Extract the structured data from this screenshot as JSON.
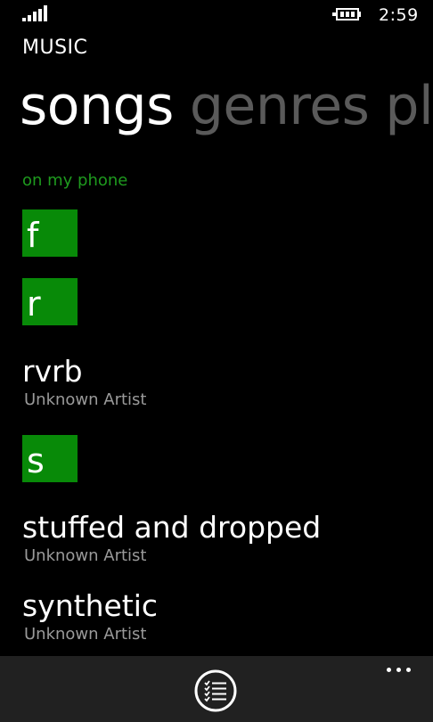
{
  "status_bar": {
    "signal_icon": "signal-strength-icon",
    "battery_icon": "battery-charging-icon",
    "time": "2:59"
  },
  "app": {
    "title": "MUSIC"
  },
  "pivot": {
    "items": [
      {
        "label": "songs",
        "active": true
      },
      {
        "label": "genres",
        "active": false
      },
      {
        "label": "playlists",
        "active": false
      }
    ]
  },
  "list": {
    "section_label": "on my phone",
    "groups": [
      {
        "letter": "f",
        "songs": []
      },
      {
        "letter": "r",
        "songs": [
          {
            "title": "rvrb",
            "artist": "Unknown Artist"
          }
        ]
      },
      {
        "letter": "s",
        "songs": [
          {
            "title": "stuffed and dropped",
            "artist": "Unknown Artist"
          },
          {
            "title": "synthetic",
            "artist": "Unknown Artist"
          }
        ]
      }
    ]
  },
  "app_bar": {
    "primary_button_icon": "select-list-icon",
    "more_icon": "ellipsis-icon"
  },
  "colors": {
    "accent": "#088a08",
    "section_label": "#1e9a1e",
    "background": "#000000",
    "app_bar": "#212121",
    "inactive_pivot": "#5a5a5a",
    "secondary_text": "#9a9a9a"
  }
}
